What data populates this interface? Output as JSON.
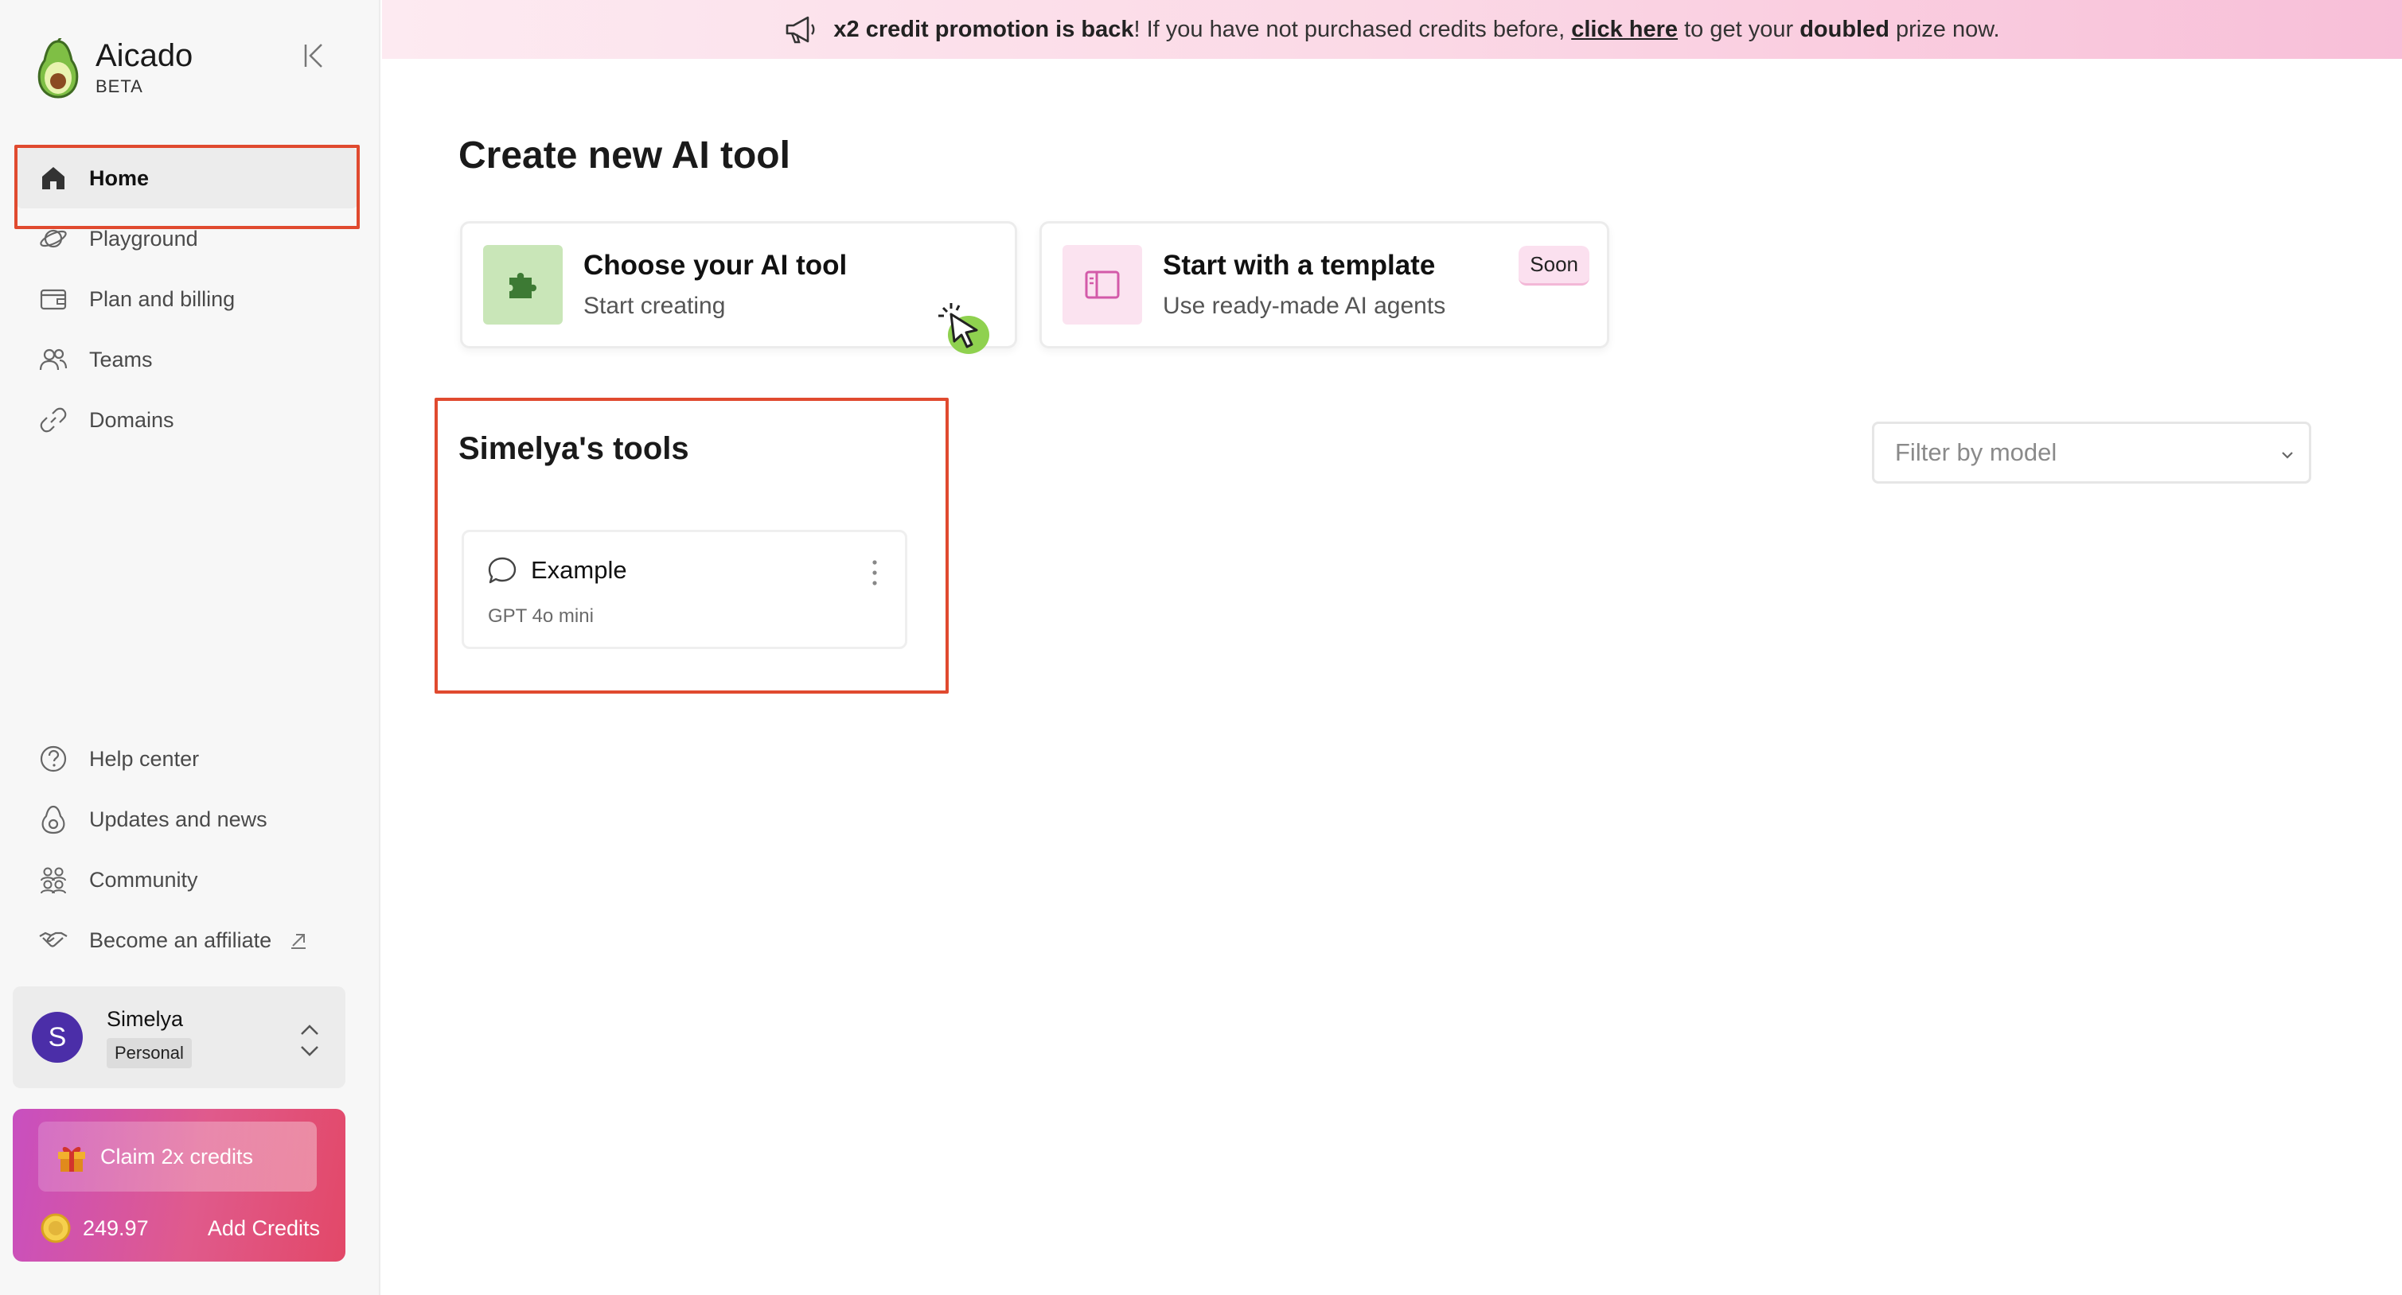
{
  "brand": {
    "name": "Aicado",
    "badge": "BETA"
  },
  "sidebar": {
    "nav_top": [
      {
        "label": "Home",
        "icon": "home-icon",
        "active": true
      },
      {
        "label": "Playground",
        "icon": "planet-icon"
      },
      {
        "label": "Plan and billing",
        "icon": "wallet-icon"
      },
      {
        "label": "Teams",
        "icon": "users-icon"
      },
      {
        "label": "Domains",
        "icon": "link-icon"
      }
    ],
    "nav_bottom": [
      {
        "label": "Help center",
        "icon": "help-icon"
      },
      {
        "label": "Updates and news",
        "icon": "avocado-outline-icon"
      },
      {
        "label": "Community",
        "icon": "community-icon"
      },
      {
        "label": "Become an affiliate",
        "icon": "handshake-icon"
      }
    ],
    "user": {
      "initial": "S",
      "name": "Simelya",
      "plan": "Personal"
    },
    "credits": {
      "claim_label": "Claim 2x credits",
      "balance": "249.97",
      "add_label": "Add Credits"
    }
  },
  "banner": {
    "part1": "x2 credit promotion is back",
    "part2": "! If you have not purchased credits before, ",
    "link": "click here",
    "part3": " to get your ",
    "part4": "doubled",
    "part5": " prize now."
  },
  "main": {
    "title": "Create new AI tool",
    "cards": {
      "choose": {
        "title": "Choose your AI tool",
        "subtitle": "Start creating"
      },
      "template": {
        "title": "Start with a template",
        "subtitle": "Use ready-made AI agents",
        "badge": "Soon"
      }
    },
    "tools_section": {
      "title": "Simelya's tools",
      "filter_placeholder": "Filter by model",
      "tools": [
        {
          "name": "Example",
          "model": "GPT 4o mini"
        }
      ]
    }
  },
  "colors": {
    "accent_highlight": "#e04a2f",
    "avatar": "#4b2ea8",
    "credits_gradient_start": "#c84fc0",
    "credits_gradient_end": "#e24868",
    "choose_icon_bg": "#c9e6b8",
    "template_icon_bg": "#fbe3f0"
  }
}
